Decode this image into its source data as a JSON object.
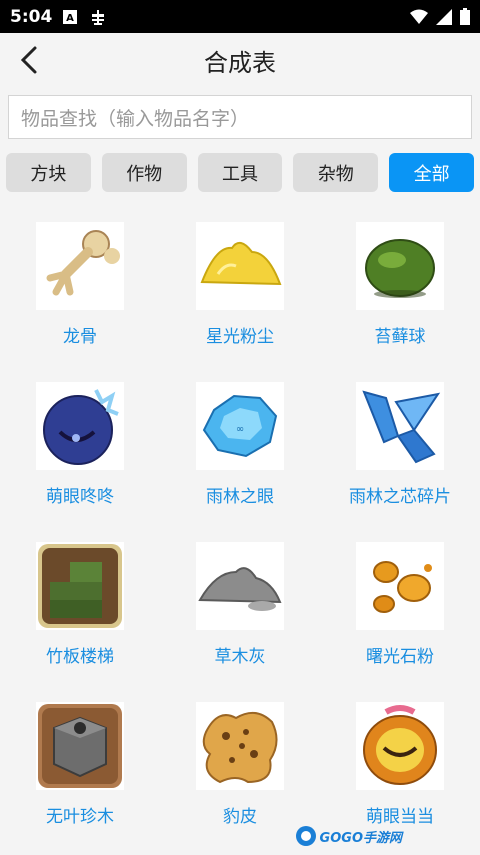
{
  "status_bar": {
    "time": "5:04"
  },
  "header": {
    "title": "合成表"
  },
  "search": {
    "placeholder": "物品查找（输入物品名字）"
  },
  "tabs": [
    {
      "label": "方块",
      "active": false
    },
    {
      "label": "作物",
      "active": false
    },
    {
      "label": "工具",
      "active": false
    },
    {
      "label": "杂物",
      "active": false
    },
    {
      "label": "全部",
      "active": true
    }
  ],
  "items": [
    {
      "name": "龙骨",
      "icon": "bone-claw-icon"
    },
    {
      "name": "星光粉尘",
      "icon": "yellow-dust-pile-icon"
    },
    {
      "name": "苔藓球",
      "icon": "moss-ball-icon"
    },
    {
      "name": "萌眼咚咚",
      "icon": "blue-eye-egg-icon"
    },
    {
      "name": "雨林之眼",
      "icon": "blue-gem-icon"
    },
    {
      "name": "雨林之芯碎片",
      "icon": "blue-crystal-shard-icon"
    },
    {
      "name": "竹板楼梯",
      "icon": "bamboo-stairs-icon"
    },
    {
      "name": "草木灰",
      "icon": "grey-ash-pile-icon"
    },
    {
      "name": "曙光石粉",
      "icon": "amber-stone-powder-icon"
    },
    {
      "name": "无叶珍木",
      "icon": "stone-block-icon"
    },
    {
      "name": "豹皮",
      "icon": "leopard-skin-icon"
    },
    {
      "name": "萌眼当当",
      "icon": "golden-eye-shell-icon"
    }
  ],
  "watermark": {
    "text": "GOGO手游网"
  },
  "colors": {
    "accent": "#0a95f5",
    "label": "#1a8ee0",
    "tab_bg": "#dddddd"
  }
}
